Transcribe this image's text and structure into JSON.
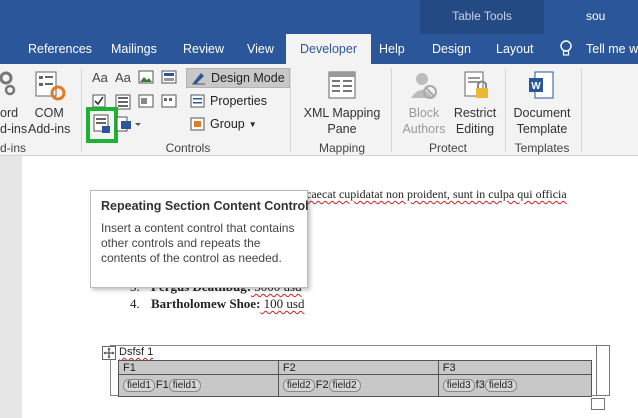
{
  "window": {
    "context_tab_group": "Table Tools",
    "title_right": "sou"
  },
  "tabs": [
    {
      "label": "References"
    },
    {
      "label": "Mailings"
    },
    {
      "label": "Review"
    },
    {
      "label": "View"
    },
    {
      "label": "Developer",
      "active": true
    },
    {
      "label": "Help"
    },
    {
      "label": "Design"
    },
    {
      "label": "Layout"
    },
    {
      "label": "Tell me wh"
    }
  ],
  "ribbon": {
    "addins": {
      "word_addins_line1": "ord",
      "word_addins_line2": "d-ins",
      "com_line1": "COM",
      "com_line2": "Add-ins",
      "group_label": "d-ins"
    },
    "controls": {
      "design_mode": "Design Mode",
      "properties": "Properties",
      "group": "Group",
      "group_label": "Controls"
    },
    "mapping": {
      "xml_line1": "XML Mapping",
      "xml_line2": "Pane",
      "group_label": "Mapping"
    },
    "protect": {
      "block_line1": "Block",
      "block_line2": "Authors",
      "restrict_line1": "Restrict",
      "restrict_line2": "Editing",
      "group_label": "Protect"
    },
    "templates": {
      "doc_line1": "Document",
      "doc_line2": "Template",
      "group_label": "Templates"
    }
  },
  "tooltip": {
    "title": "Repeating Section Content Control",
    "body": "Insert a content control that contains other controls and repeats the contents of the control as needed."
  },
  "document": {
    "top_line": "caecat cupidatat non proident, sunt in culpa qui officia",
    "list": [
      {
        "num": "3.",
        "name": "Fergus Deathbug:",
        "value": " 5000 usd"
      },
      {
        "num": "4.",
        "name": "Bartholomew Shoe:",
        "value": " 100 usd"
      }
    ],
    "table_caption": "Dsfsf 1",
    "table_headers": [
      "F1",
      "F2",
      "F3"
    ],
    "table_row": [
      {
        "a": "field1",
        "b": "F1",
        "c": "field1"
      },
      {
        "a": "field2",
        "b": "F2",
        "c": "field2"
      },
      {
        "a": "field3",
        "b": "f3",
        "c": "field3"
      }
    ]
  },
  "colors": {
    "accent": "#2b579a",
    "highlight": "#1db233"
  }
}
